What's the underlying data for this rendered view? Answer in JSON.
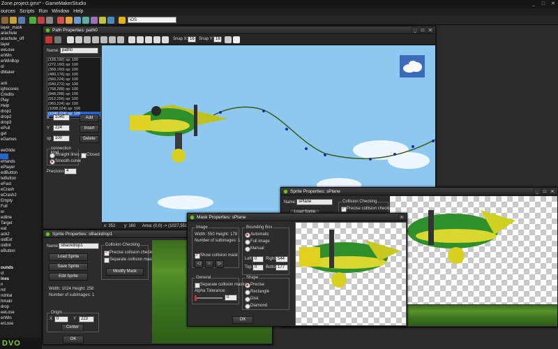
{
  "app": {
    "title": "Zone.project.gmx* - GameMakerStudio",
    "window_controls": [
      "_",
      "□",
      "✕"
    ]
  },
  "menu": [
    "ources",
    "Scripts",
    "Run",
    "Window",
    "Help"
  ],
  "toolbar": {
    "search_value": "iOS"
  },
  "tree": {
    "items": [
      "layer_mask",
      "arachute",
      "arachute_off",
      "layer",
      "eeLose",
      "erWin",
      "erWinBop",
      "ol",
      "dMaker",
      "",
      "ack",
      "ighscores",
      "Credits",
      "Play",
      "Help",
      "drop1",
      "drop2",
      "drop3",
      "ePull",
      "get",
      "eGames",
      "",
      "eeGlide",
      "",
      "eHands",
      "ePlayer",
      "edButton",
      "teButton",
      "eFast",
      "eCrash",
      "eCrash2",
      "Empty",
      "Full",
      "er",
      "edline",
      "Target",
      "eat",
      "ack2",
      "oidExt",
      "oidInt",
      "eButton",
      "",
      ""
    ],
    "header1": "ounds",
    "header1_item": "ct",
    "header2": "ines",
    "bottom_items": [
      "n",
      "nd",
      "ndrital",
      "hmakr",
      "drop",
      "eeLose",
      "erWin",
      "erLose"
    ],
    "logo": "DVO"
  },
  "path_window": {
    "title": "Path Properties: path0",
    "snap_x_label": "Snap X:",
    "snap_x": "16",
    "snap_y_label": "Snap Y:",
    "snap_y": "16",
    "name_label": "Name:",
    "name": "path0",
    "points": [
      "(128,192)  sp: 100",
      "(272,160)  sp: 100",
      "(368,160)  sp: 100",
      "(480,176)  sp: 100",
      "(560,224)  sp: 100",
      "(640,272)  sp: 100",
      "(768,288)  sp: 100",
      "(848,288)  sp: 100",
      "(912,256)  sp: 100",
      "(960,224)  sp: 100",
      "(1008,224)  sp: 100",
      "(1040,224)  sp: 100"
    ],
    "x_label": "X",
    "x_value": "1040",
    "y_label": "Y",
    "y_value": "224",
    "sp_label": "sp",
    "sp_value": "100",
    "add_button": "Add",
    "insert_button": "Insert",
    "delete_button": "Delete",
    "connection_kind_label": "connection kind",
    "straight_lines": "Straight lines",
    "smooth_curve": "Smooth curve",
    "closed_label": "Closed",
    "precision_label": "Precision:",
    "precision_value": "4",
    "status_x": "x: 352",
    "status_y": "y: 160",
    "status_area": "Area: (0,0) -> (1027,551)"
  },
  "sprite_backdrop_window": {
    "title": "Sprite Properties: sBackdrop1",
    "name_label": "Name:",
    "name": "sBackdrop1",
    "load_sprite": "Load Sprite",
    "save_sprite": "Save Sprite",
    "edit_sprite": "Edit Sprite",
    "width_height": "Width: 1024   Height: 258",
    "subimages": "Number of subimages: 1",
    "collision_group": "Collision Checking",
    "precise_collision": "Precise collision checking",
    "separate_masks": "Separate collision masks",
    "modify_mask": "Modify Mask",
    "origin_label": "Origin",
    "x_label": "X",
    "origin_x": "0",
    "y_label": "Y",
    "origin_y": "223",
    "center_button": "Center",
    "ok_button": "OK"
  },
  "sprite_plane_window": {
    "title": "Sprite Properties: sPlane",
    "name_label": "Name:",
    "name": "sPlane",
    "collision_group": "Collision Checking",
    "precise_collision": "Precise collision checking",
    "load_sprite": "Load Sprite"
  },
  "mask_window": {
    "title": "Mask Properties: sPlane",
    "image_group": "Image",
    "width_height": "Width: 550   Height: 178",
    "subimages": "Number of subimages: 1",
    "show_mask": "Show collision mask",
    "general_group": "General",
    "separate_masks": "Separate collision masks",
    "alpha_label": "Alpha Tolerance:",
    "alpha_value": "0",
    "bbox_group": "Bounding Box",
    "automatic": "Automatic",
    "full_image": "Full image",
    "manual": "Manual",
    "left_label": "Left",
    "left_value": "0",
    "right_label": "Right",
    "right_value": "544",
    "top_label": "Top",
    "top_value": "0",
    "bottom_label": "Bottom",
    "bottom_value": "177",
    "shape_group": "Shape",
    "precise": "Precise",
    "rectangle": "Rectangle",
    "disk": "Disk",
    "diamond": "Diamond",
    "ok_button": "OK"
  },
  "colors": {
    "sky": "#8cc8f0",
    "accent_selection": "#2a63c6",
    "gm_green": "#6cbf2f",
    "path_line": "#3d5a1a",
    "path_point": "#1a2ea8"
  }
}
